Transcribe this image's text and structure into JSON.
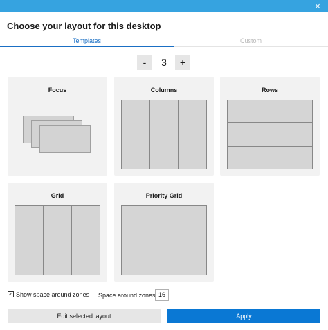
{
  "window": {
    "close_glyph": "×"
  },
  "heading": "Choose your layout for this desktop",
  "tabs": [
    {
      "label": "Templates",
      "active": true
    },
    {
      "label": "Custom",
      "active": false
    }
  ],
  "zone_count": {
    "minus_label": "-",
    "value": "3",
    "plus_label": "+"
  },
  "layouts": [
    {
      "id": "focus",
      "label": "Focus"
    },
    {
      "id": "columns",
      "label": "Columns"
    },
    {
      "id": "rows",
      "label": "Rows"
    },
    {
      "id": "grid",
      "label": "Grid"
    },
    {
      "id": "priority-grid",
      "label": "Priority Grid"
    }
  ],
  "options": {
    "show_space_label": "Show space around zones",
    "show_space_checked": true,
    "check_glyph": "✓",
    "space_label": "Space around zones",
    "space_value": "16"
  },
  "buttons": {
    "edit_label": "Edit selected layout",
    "apply_label": "Apply"
  },
  "colors": {
    "titlebar": "#36a3e0",
    "accent": "#1a6fc4",
    "apply": "#0a78d4",
    "card": "#f2f2f2",
    "zone": "#d5d5d5"
  }
}
